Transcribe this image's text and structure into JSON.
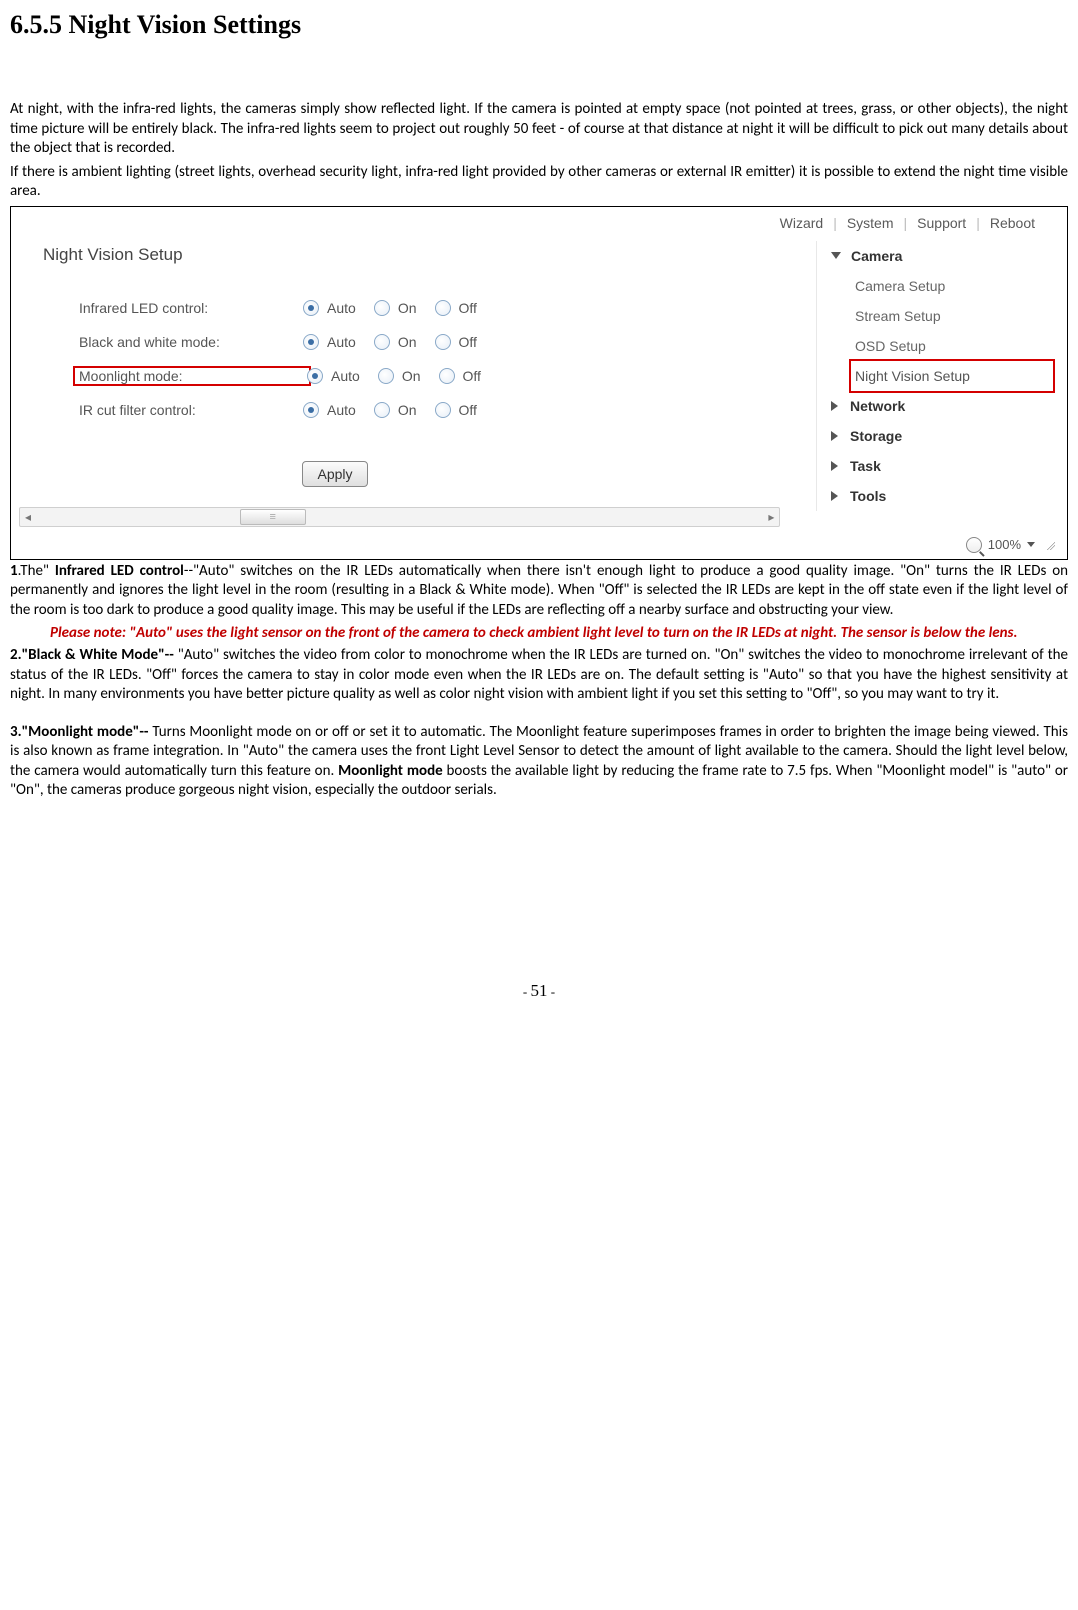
{
  "heading": "6.5.5 Night Vision Settings",
  "para1": "At night, with the infra-red lights, the cameras simply show reflected light. If the camera is pointed at empty space (not pointed at trees, grass, or other objects), the night time picture will be entirely black. The infra-red lights seem to project out roughly 50 feet - of course at that distance at night it will be difficult to pick out many details about the object that is recorded.",
  "para2": "If there is ambient lighting (street lights, overhead security light, infra-red light provided by other cameras or external IR emitter) it is possible to extend the night time visible area.",
  "ui": {
    "toplinks": {
      "wizard": "Wizard",
      "system": "System",
      "support": "Support",
      "reboot": "Reboot"
    },
    "panel_title": "Night Vision Setup",
    "rows": [
      {
        "label": "Infrared LED control:"
      },
      {
        "label": "Black and white mode:"
      },
      {
        "label": "Moonlight mode:"
      },
      {
        "label": "IR cut filter control:"
      }
    ],
    "opt_auto": "Auto",
    "opt_on": "On",
    "opt_off": "Off",
    "apply": "Apply",
    "sidebar": {
      "camera": "Camera",
      "camera_setup": "Camera Setup",
      "stream_setup": "Stream Setup",
      "osd_setup": "OSD Setup",
      "night_vision": "Night Vision Setup",
      "network": "Network",
      "storage": "Storage",
      "task": "Task",
      "tools": "Tools"
    },
    "zoom": "100%"
  },
  "text_after": {
    "p1_lead": "1",
    "p1_body_pre": ".The\" ",
    "p1_bold": "Infrared LED control",
    "p1_body_post": "--\"Auto\" switches on the IR LEDs automatically when there isn't enough light to produce a good quality image. \"On\" turns the IR LEDs on permanently and ignores the light level in the room (resulting in a Black & White mode). When \"Off\" is selected the IR LEDs are kept in the off state even if the light level of the room is too dark to produce a good quality image. This may be useful if the LEDs are reflecting off a nearby surface and obstructing your view.",
    "pnote": "Please note: \"Auto\" uses the light sensor on the front of the camera to check ambient light level to turn on the IR LEDs at night. The sensor is below the lens.",
    "p2_bold": "2.\"Black & White Mode\"--",
    "p2_body": " \"Auto\" switches the video from color to monochrome when the IR LEDs are turned on. \"On\" switches the video to monochrome irrelevant of the status of the IR LEDs. \"Off\" forces the camera to stay in color mode even when the IR LEDs are on. The default setting is \"Auto\" so that you have the highest sensitivity at night. In many environments you have better picture quality as well as color night vision with ambient light if you set this setting to \"Off\", so you may want to try it.",
    "p3_bold1": "3.\"Moonlight mode\"--",
    "p3_mid": " Turns Moonlight mode on or off or set it to automatic. The Moonlight feature superimposes frames in order to brighten the image being viewed. This is also known as frame integration. In \"Auto\" the camera uses the front Light Level Sensor to detect the amount of light available to the camera. Should the light level below, the camera would automatically turn this feature on. ",
    "p3_bold2": "Moonlight mode",
    "p3_end": " boosts the available light by reducing the frame rate to 7.5 fps. When \"Moonlight model\" is \"auto\" or \"On\", the cameras produce gorgeous night vision, especially the outdoor serials."
  },
  "page_no": "51"
}
